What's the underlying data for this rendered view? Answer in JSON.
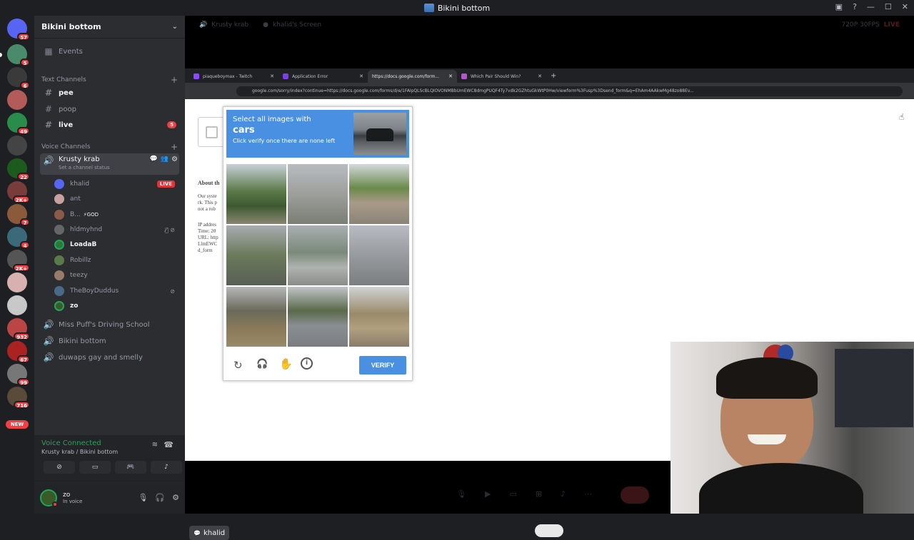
{
  "window": {
    "title": "Bikini bottom"
  },
  "rail": {
    "badges": [
      "57",
      "5",
      "6",
      "49",
      "22",
      "2K+",
      "7",
      "4",
      "2K+",
      "932",
      "67",
      "99",
      "716"
    ],
    "new_label": "NEW"
  },
  "server": {
    "name": "Bikini bottom"
  },
  "events_label": "Events",
  "text_channels": {
    "category": "Text Channels",
    "items": [
      {
        "name": "pee"
      },
      {
        "name": "poop"
      },
      {
        "name": "live",
        "badge": "5"
      }
    ]
  },
  "voice_channels": {
    "category": "Voice Channels",
    "active": {
      "name": "Krusty krab",
      "status": "Set a channel status"
    },
    "users": [
      {
        "name": "khalid",
        "badge": "LIVE"
      },
      {
        "name": "ant"
      },
      {
        "name": "B...",
        "tag": "⚡GOD"
      },
      {
        "name": "hldmyhnd"
      },
      {
        "name": "LoadaB"
      },
      {
        "name": "Robillz"
      },
      {
        "name": "teezy"
      },
      {
        "name": "TheBoyDuddus"
      },
      {
        "name": "zo"
      }
    ],
    "others": [
      "Miss Puff's Driving School",
      "Bikini bottom",
      "duwaps gay and smelly"
    ]
  },
  "voice_panel": {
    "status": "Voice Connected",
    "location": "Krusty krab / Bikini bottom"
  },
  "user_panel": {
    "name": "zo",
    "status": "In voice"
  },
  "stream_bar": {
    "channel": "Krusty krab",
    "screen": "khalid's Screen",
    "quality": "720P 30FPS",
    "live": "LIVE"
  },
  "browser": {
    "tabs": [
      {
        "title": "piaqueboymax - Twitch"
      },
      {
        "title": "Application Error"
      },
      {
        "title": "https://docs.google.com/form..."
      },
      {
        "title": "Which Pair Should Win?"
      }
    ],
    "url": "google.com/sorry/index?continue=https://docs.google.com/forms/d/e/1FAIpQLScBLQIOVONMBbUmEWC8dmgPUQF4Ty7vdk2GZhtuGkWtP0Hw/viewform%3Fusp%3Dsend_form&q=EhAm4AAkwMg48zo88Ev..."
  },
  "page": {
    "about": "About th",
    "lines": [
      "Our syste",
      "rk. This p",
      "not a rob",
      "",
      "IP addres",
      "Time: 20",
      "URL: http",
      "LlmEWC",
      "d_form"
    ]
  },
  "captcha": {
    "line1": "Select all images with",
    "target": "cars",
    "line2": "Click verify once there are none left",
    "verify_label": "VERIFY"
  },
  "chat_chip": "khalid",
  "colors": {
    "discord_bg": "#1e1f22",
    "sidebar": "#2b2d31",
    "captcha_blue": "#4a90e2",
    "live_red": "#da373c",
    "voice_green": "#23a55a"
  }
}
